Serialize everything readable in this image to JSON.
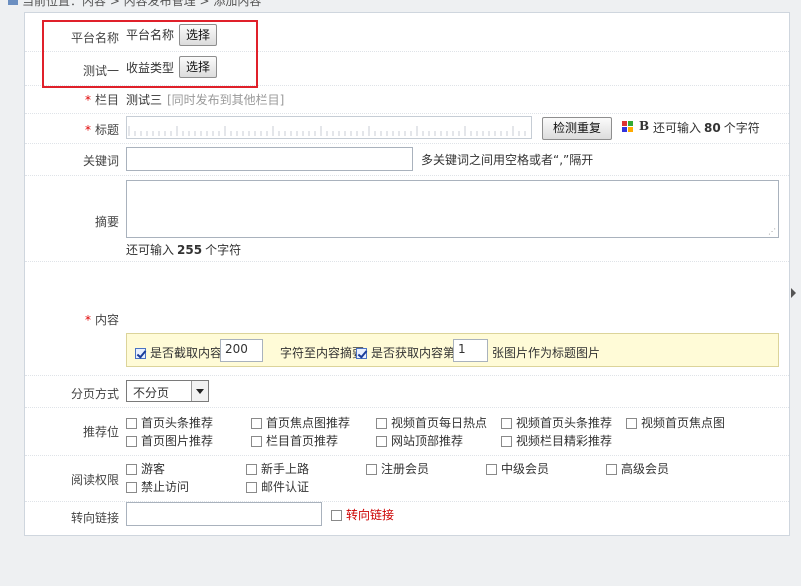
{
  "breadcrumb": "当前位置：内容 > 内容发布管理 > 添加内容",
  "platform": {
    "label": "平台名称",
    "value": "平台名称",
    "button": "选择"
  },
  "test": {
    "label": "测试一",
    "value": "收益类型",
    "button": "选择"
  },
  "column": {
    "label": "栏目",
    "value": "测试三",
    "link": "[同时发布到其他栏目]"
  },
  "title": {
    "label": "标题",
    "button": "检测重复",
    "bold_icon": "B",
    "remain_prefix": "还可输入",
    "remain_count": "80",
    "remain_suffix": "个字符"
  },
  "keywords": {
    "label": "关键词",
    "hint": "多关键词之间用空格或者“,”隔开"
  },
  "summary": {
    "label": "摘要",
    "remain_prefix": "还可输入",
    "remain_count": "255",
    "remain_suffix": "个字符"
  },
  "content": {
    "label": "内容",
    "opt1_label": "是否截取内容",
    "opt1_value": "200",
    "opt1_suffix": "字符至内容摘要",
    "opt2_label": "是否获取内容第",
    "opt2_value": "1",
    "opt2_suffix": "张图片作为标题图片"
  },
  "paging": {
    "label": "分页方式",
    "value": "不分页"
  },
  "recommend": {
    "label": "推荐位",
    "items": [
      "首页头条推荐",
      "首页焦点图推荐",
      "视频首页每日热点",
      "视频首页头条推荐",
      "视频首页焦点图",
      "首页图片推荐",
      "栏目首页推荐",
      "网站顶部推荐",
      "视频栏目精彩推荐"
    ]
  },
  "permission": {
    "label": "阅读权限",
    "items": [
      "游客",
      "新手上路",
      "注册会员",
      "中级会员",
      "高级会员",
      "禁止访问",
      "邮件认证"
    ]
  },
  "redirect": {
    "label": "转向链接",
    "checkbox_label": "转向链接"
  },
  "colors": {
    "required": "#e00000",
    "highlight_box": "#e0202a",
    "option_bg": "#fffbd7",
    "redirect_text": "#cc0000"
  }
}
